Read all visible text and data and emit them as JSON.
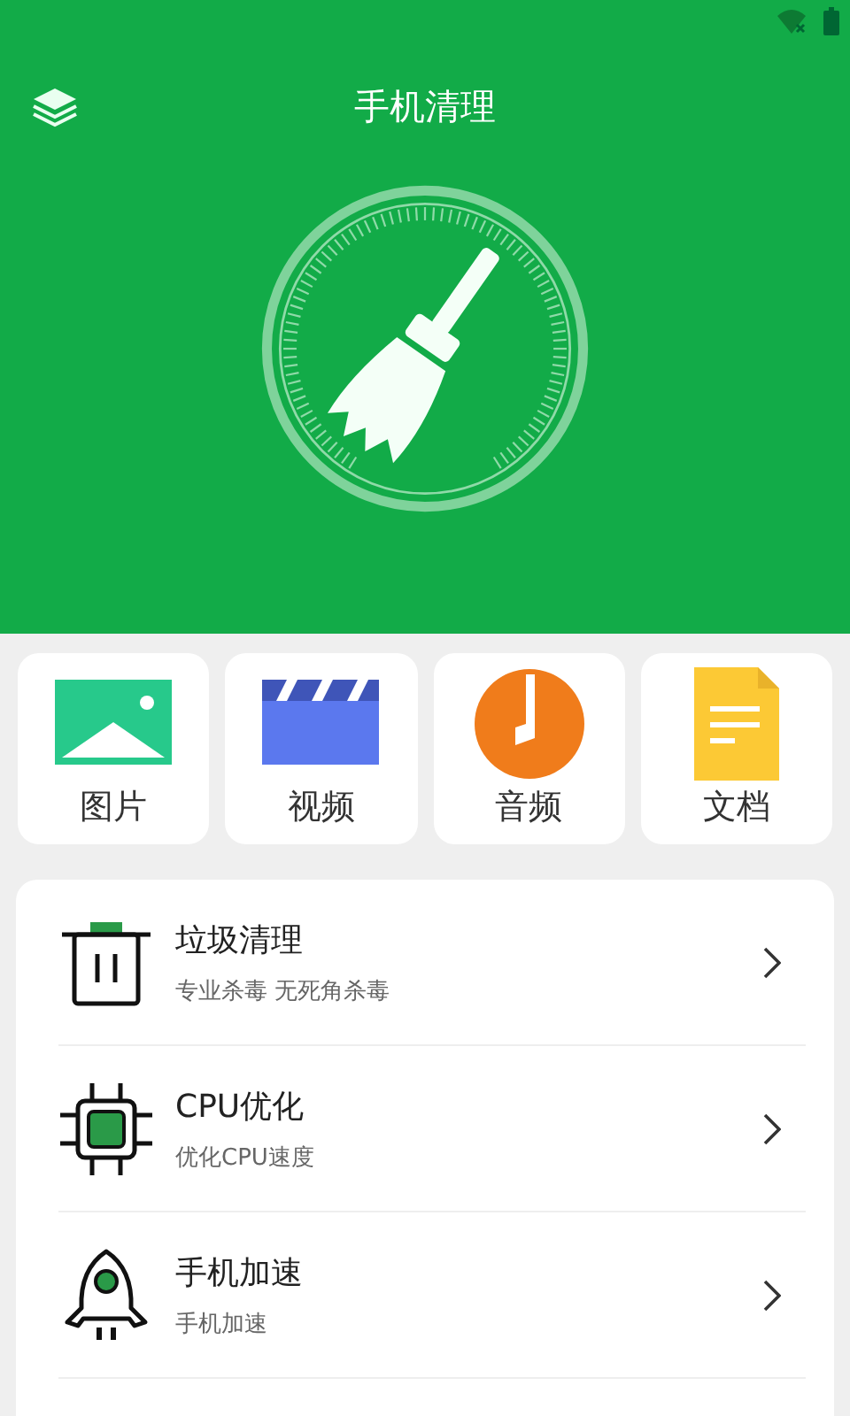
{
  "header": {
    "title": "手机清理"
  },
  "categories": [
    {
      "kind": "image",
      "label": "图片"
    },
    {
      "kind": "video",
      "label": "视频"
    },
    {
      "kind": "audio",
      "label": "音频"
    },
    {
      "kind": "doc",
      "label": "文档"
    }
  ],
  "features": [
    {
      "kind": "trash",
      "title": "垃圾清理",
      "subtitle": "专业杀毒 无死角杀毒"
    },
    {
      "kind": "cpu",
      "title": "CPU优化",
      "subtitle": "优化CPU速度"
    },
    {
      "kind": "rocket",
      "title": "手机加速",
      "subtitle": "手机加速"
    }
  ]
}
